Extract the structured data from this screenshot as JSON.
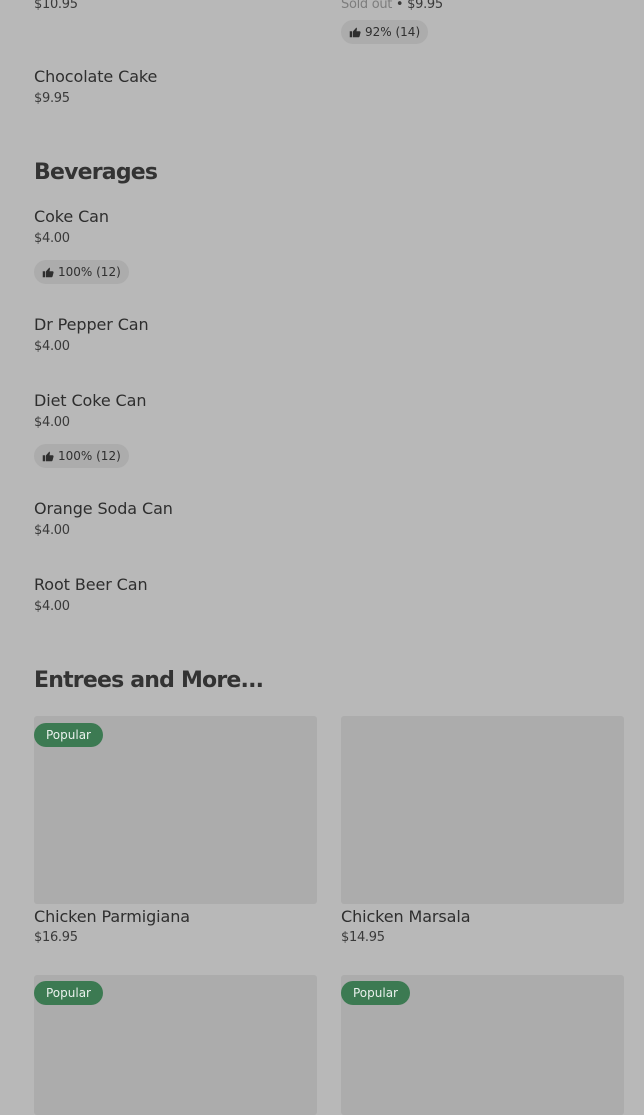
{
  "top_row": {
    "left_price": "$10.95",
    "right_sold_out": "Sold out",
    "right_separator": " • ",
    "right_price": "$9.95",
    "right_rating": "92% (14)"
  },
  "chocolate_cake": {
    "name": "Chocolate Cake",
    "price": "$9.95"
  },
  "beverages": {
    "title": "Beverages",
    "items": [
      {
        "name": "Coke Can",
        "price": "$4.00",
        "rating": "100% (12)"
      },
      {
        "name": "Dr Pepper Can",
        "price": "$4.00"
      },
      {
        "name": "Diet Coke Can",
        "price": "$4.00",
        "rating": "100% (12)"
      },
      {
        "name": "Orange Soda Can",
        "price": "$4.00"
      },
      {
        "name": "Root Beer Can",
        "price": "$4.00"
      }
    ]
  },
  "entrees": {
    "title": "Entrees and More...",
    "cards": [
      {
        "name": "Chicken Parmigiana",
        "price": "$16.95",
        "badge": "Popular"
      },
      {
        "name": "Chicken Marsala",
        "price": "$14.95"
      },
      {
        "badge": "Popular"
      },
      {
        "badge": "Popular"
      }
    ]
  },
  "colors": {
    "background": "#b8b8b8",
    "card": "#acacac",
    "popular_badge": "#3c7a52",
    "text": "#303030"
  },
  "icons": {
    "rating": "thumbs-up-icon"
  }
}
